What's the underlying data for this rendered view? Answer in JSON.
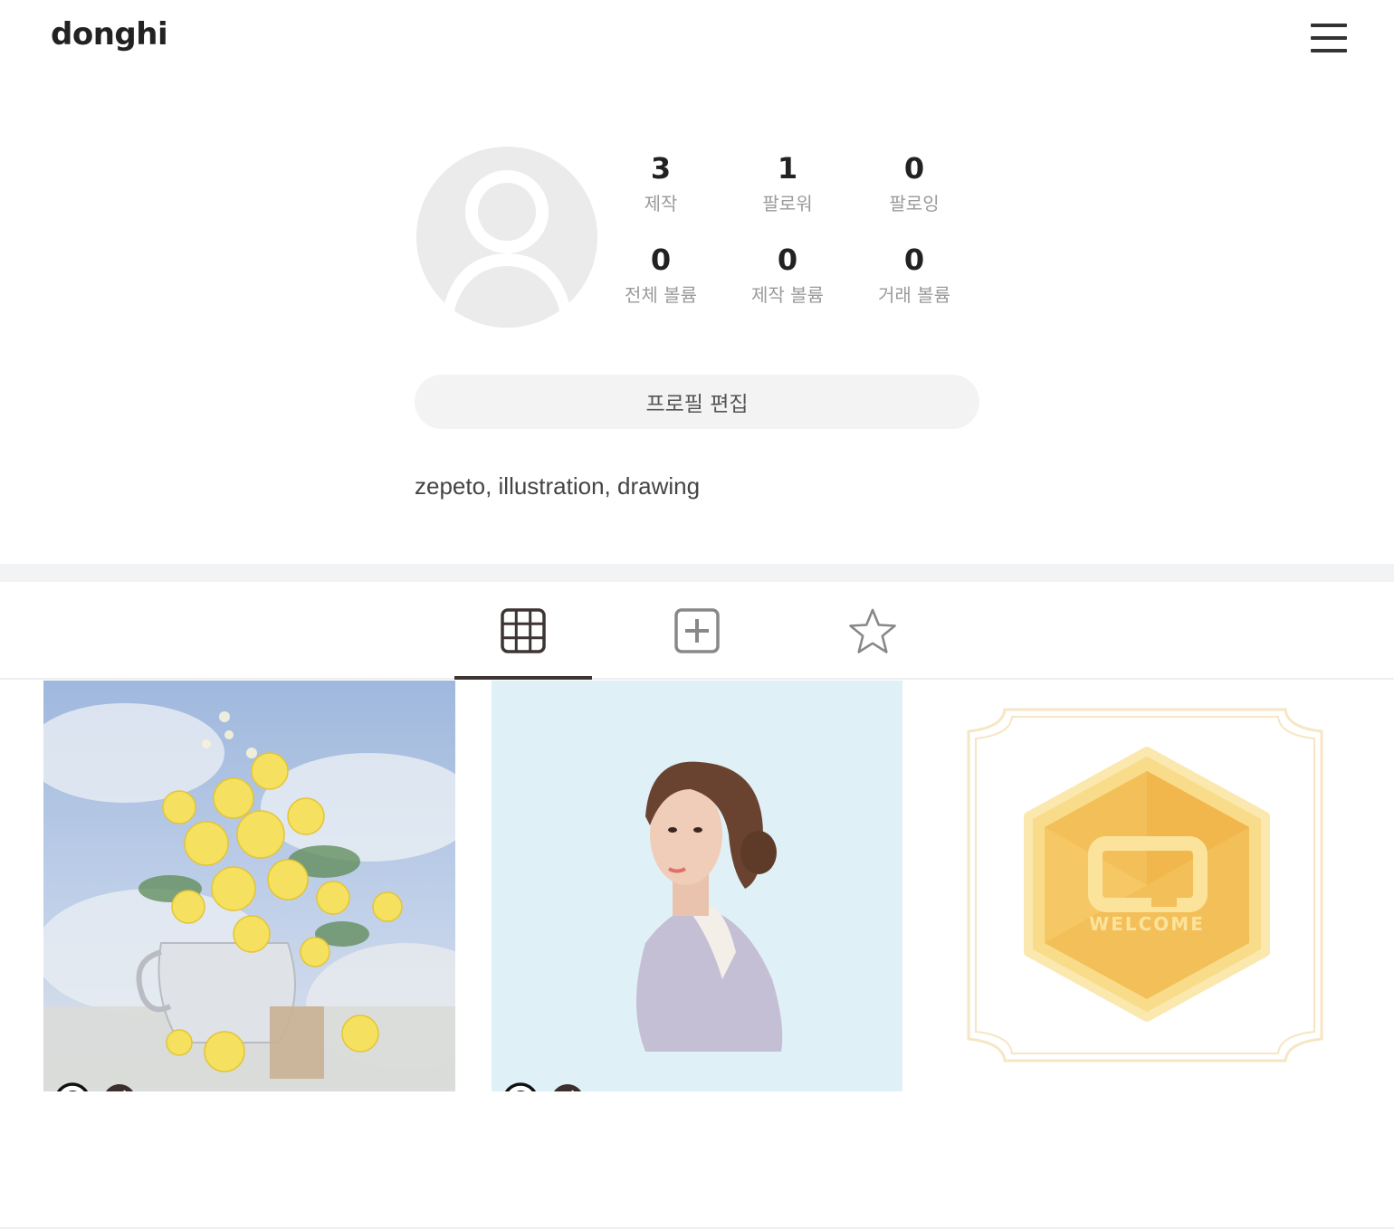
{
  "header": {
    "title": "donghi",
    "menu_icon": "hamburger-menu-icon"
  },
  "profile": {
    "avatar_icon": "default-user-icon",
    "stats": [
      {
        "value": "3",
        "label": "제작"
      },
      {
        "value": "1",
        "label": "팔로워"
      },
      {
        "value": "0",
        "label": "팔로잉"
      },
      {
        "value": "0",
        "label": "전체 볼륨"
      },
      {
        "value": "0",
        "label": "제작 볼륨"
      },
      {
        "value": "0",
        "label": "거래 볼륨"
      }
    ],
    "edit_button_label": "프로필 편집",
    "bio": "zepeto, illustration, drawing"
  },
  "tabs": [
    {
      "icon": "grid-icon",
      "active": true
    },
    {
      "icon": "plus-square-icon",
      "active": false
    },
    {
      "icon": "star-icon",
      "active": false
    }
  ],
  "artworks": [
    {
      "subject": "yellow-flowers-painting",
      "badges": [
        "copyright-icon",
        "k-logo-icon"
      ]
    },
    {
      "subject": "woman-portrait-painting",
      "badges": [
        "copyright-icon",
        "k-logo-icon"
      ]
    },
    {
      "subject": "welcome-badge",
      "badge_text": "WELCOME"
    }
  ],
  "colors": {
    "accent_tab": "#3d3533",
    "gold": "#f5c35a",
    "stat_label": "#9a9a9a"
  }
}
